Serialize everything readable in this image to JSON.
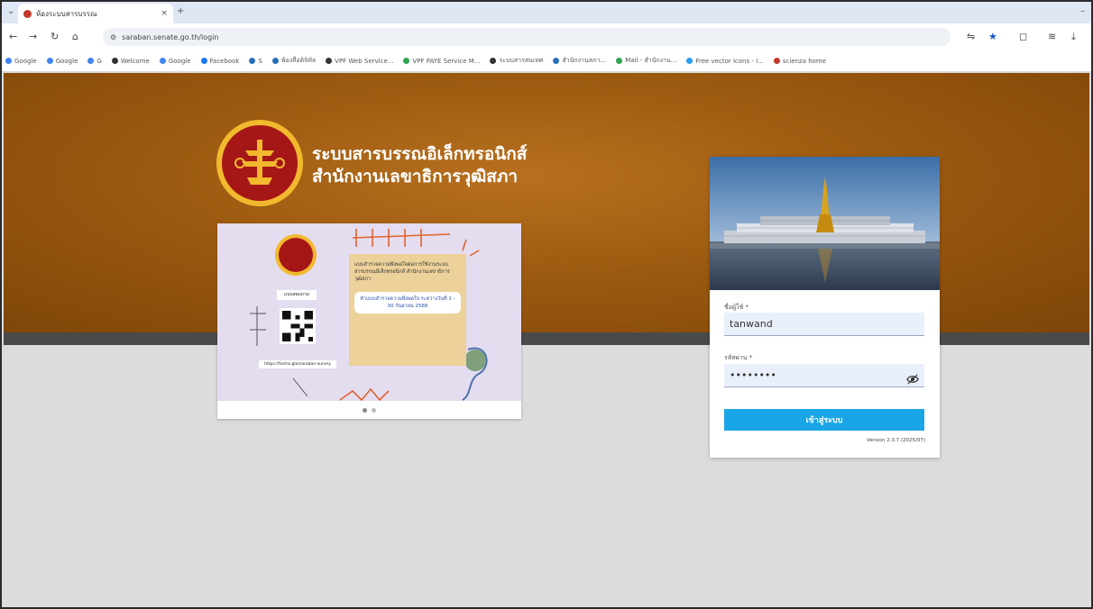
{
  "browser": {
    "tab_title": "ห้องระบบสารบรรณ",
    "tab_close": "×",
    "new_tab": "+",
    "url": "saraban.senate.go.th/login",
    "bookmarks": [
      {
        "label": "Google",
        "color": "#4285f4"
      },
      {
        "label": "Google",
        "color": "#4285f4"
      },
      {
        "label": "G",
        "color": "#4285f4"
      },
      {
        "label": "Welcome",
        "color": "#333333"
      },
      {
        "label": "Google",
        "color": "#4285f4"
      },
      {
        "label": "Facebook",
        "color": "#1877f2"
      },
      {
        "label": "S",
        "color": "#2a6ebb"
      },
      {
        "label": "ห้องสื่อดิจิทัล",
        "color": "#2a6ebb"
      },
      {
        "label": "VPF Web Service...",
        "color": "#333333"
      },
      {
        "label": "VPF PAYE Service M...",
        "color": "#2ea44f"
      },
      {
        "label": "ระบบสารสนเทศ",
        "color": "#333333"
      },
      {
        "label": "สำนักงานสภา...",
        "color": "#2a6ebb"
      },
      {
        "label": "Mail - สำนักงาน...",
        "color": "#2ea44f"
      },
      {
        "label": "Free vector icons - I...",
        "color": "#2a9df4"
      },
      {
        "label": "scienza home",
        "color": "#c0392b"
      }
    ]
  },
  "site": {
    "title_line1": "ระบบสารบรรณอิเล็กทรอนิกส์",
    "title_line2": "สำนักงานเลขาธิการวุฒิสภา"
  },
  "slide": {
    "label": "แบบสอบถาม",
    "card_text": "แบบสำรวจความพึงพอใจต่อการใช้งานระบบสารบรรณอิเล็กทรอนิกส์ สำนักงานเลขาธิการวุฒิสภา",
    "card_pill": "ทำแบบสำรวจความพึงพอใจ ระหว่างวันที่ 1 - 30 กันยายน 2568",
    "url": "https://forms.gle/saraban-survey"
  },
  "login": {
    "username_label": "ชื่อผู้ใช้ *",
    "username_value": "tanwand",
    "password_label": "รหัสผ่าน *",
    "password_value": "••••••••",
    "submit_label": "เข้าสู่ระบบ",
    "version": "Version 2.3.7 (2025/07)"
  },
  "colors": {
    "hero": "#9c5a10",
    "accent_button": "#1aa5e6"
  }
}
